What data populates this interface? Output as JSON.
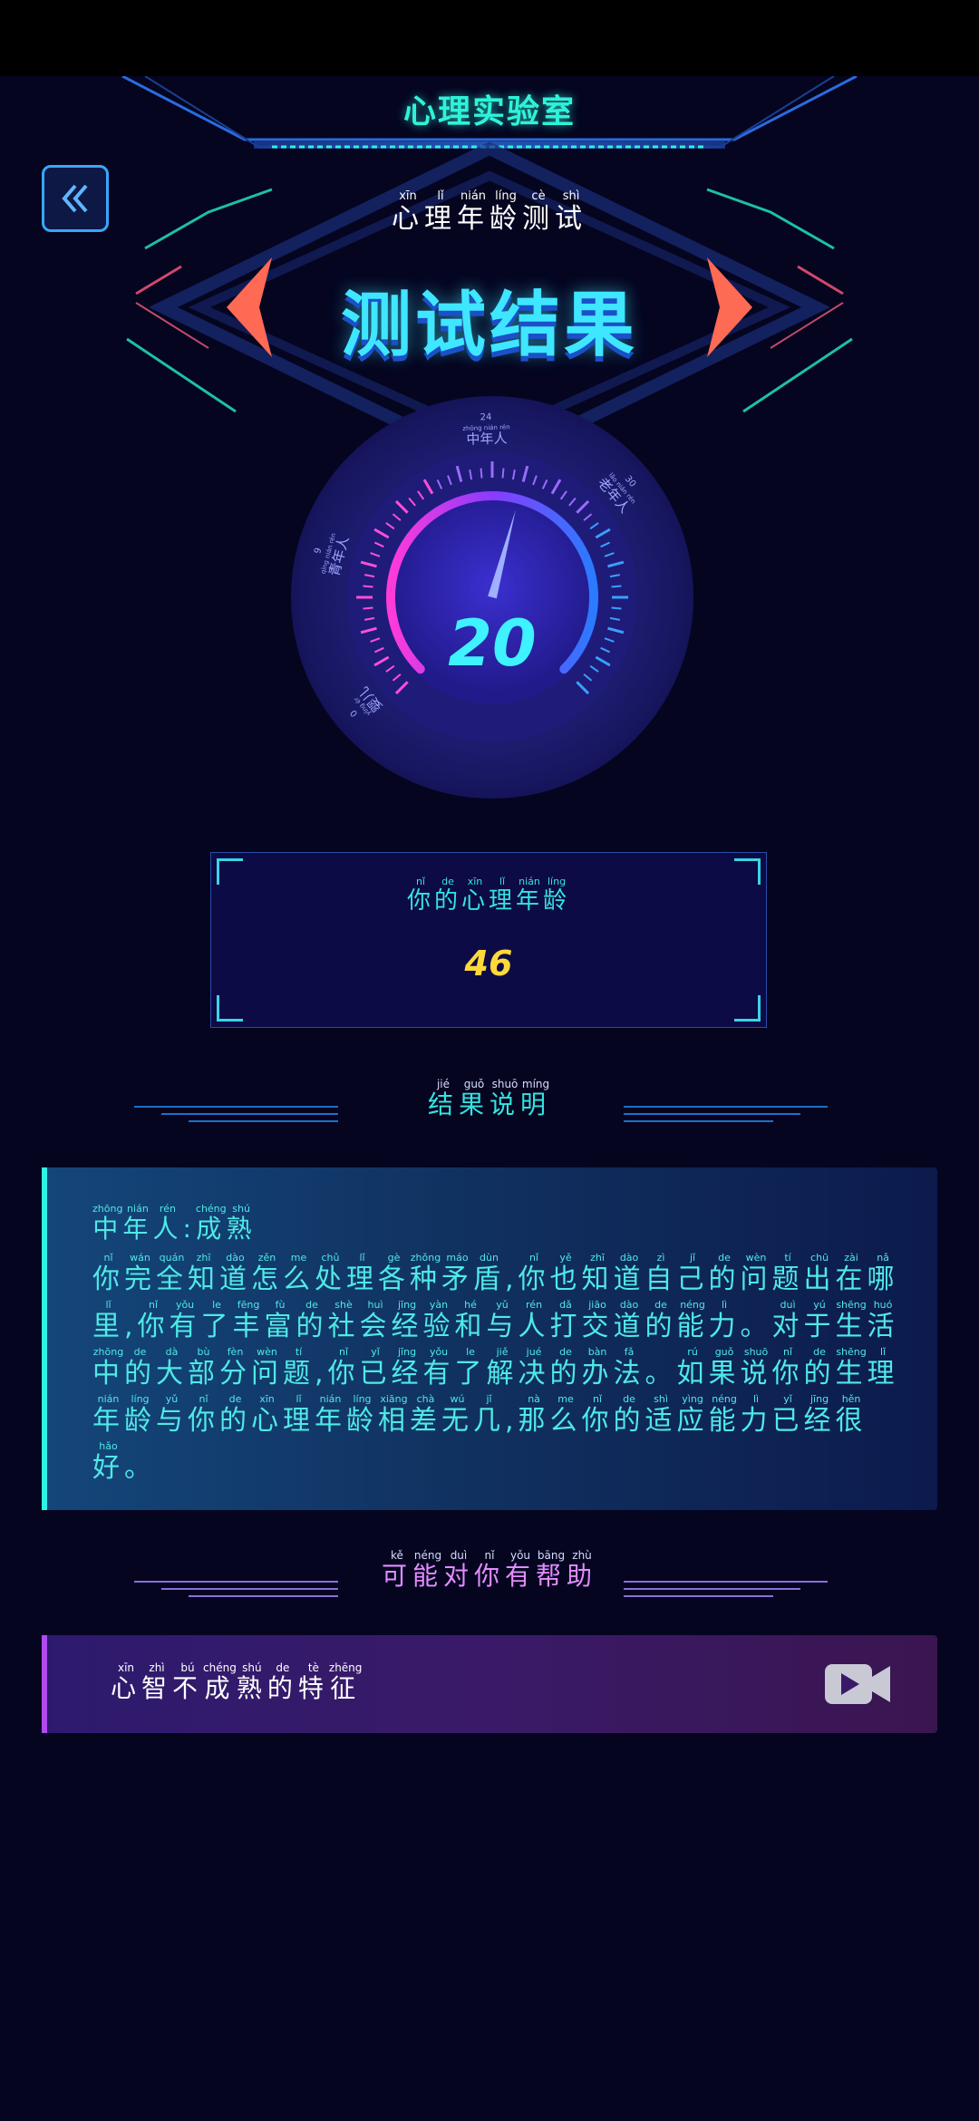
{
  "header": {
    "title": "心理实验室"
  },
  "test_name": {
    "chars": [
      {
        "c": "心",
        "p": "xīn"
      },
      {
        "c": "理",
        "p": "lǐ"
      },
      {
        "c": "年",
        "p": "nián"
      },
      {
        "c": "龄",
        "p": "líng"
      },
      {
        "c": "测",
        "p": "cè"
      },
      {
        "c": "试",
        "p": "shì"
      }
    ]
  },
  "result_title": "测试结果",
  "gauge": {
    "value": 20,
    "min": 0,
    "max": 36,
    "value_label": "20",
    "labels": [
      {
        "num": "0",
        "text": "婴儿",
        "pinyin": "yīng ér"
      },
      {
        "num": "9",
        "text": "青年人",
        "pinyin": "qīng nián rén"
      },
      {
        "num": "24",
        "text": "中年人",
        "pinyin": "zhōng nián rén"
      },
      {
        "num": "30",
        "text": "老年人",
        "pinyin": "lǎo nián rén"
      }
    ]
  },
  "score": {
    "label_chars": [
      {
        "c": "你",
        "p": "nǐ"
      },
      {
        "c": "的",
        "p": "de"
      },
      {
        "c": "心",
        "p": "xīn"
      },
      {
        "c": "理",
        "p": "lǐ"
      },
      {
        "c": "年",
        "p": "nián"
      },
      {
        "c": "龄",
        "p": "líng"
      }
    ],
    "value": "46"
  },
  "explanation_section": {
    "title_chars": [
      {
        "c": "结",
        "p": "jié"
      },
      {
        "c": "果",
        "p": "guǒ"
      },
      {
        "c": "说",
        "p": "shuō"
      },
      {
        "c": "明",
        "p": "míng"
      }
    ],
    "heading_chars": [
      {
        "c": "中",
        "p": "zhōng"
      },
      {
        "c": "年",
        "p": "nián"
      },
      {
        "c": "人",
        "p": "rén"
      },
      {
        "c": ":",
        "p": ""
      },
      {
        "c": "成",
        "p": "chéng"
      },
      {
        "c": "熟",
        "p": "shú"
      }
    ],
    "body_chars": [
      {
        "c": "你",
        "p": "nǐ"
      },
      {
        "c": "完",
        "p": "wán"
      },
      {
        "c": "全",
        "p": "quán"
      },
      {
        "c": "知",
        "p": "zhī"
      },
      {
        "c": "道",
        "p": "dào"
      },
      {
        "c": "怎",
        "p": "zěn"
      },
      {
        "c": "么",
        "p": "me"
      },
      {
        "c": "处",
        "p": "chǔ"
      },
      {
        "c": "理",
        "p": "lǐ"
      },
      {
        "c": "各",
        "p": "gè"
      },
      {
        "c": "种",
        "p": "zhǒng"
      },
      {
        "c": "矛",
        "p": "máo"
      },
      {
        "c": "盾",
        "p": "dùn"
      },
      {
        "c": ",",
        "p": ""
      },
      {
        "c": "你",
        "p": "nǐ"
      },
      {
        "c": "也",
        "p": "yě"
      },
      {
        "c": "知",
        "p": "zhī"
      },
      {
        "c": "道",
        "p": "dào"
      },
      {
        "c": "自",
        "p": "zì"
      },
      {
        "c": "己",
        "p": "jǐ"
      },
      {
        "c": "的",
        "p": "de"
      },
      {
        "c": "问",
        "p": "wèn"
      },
      {
        "c": "题",
        "p": "tí"
      },
      {
        "c": "出",
        "p": "chū"
      },
      {
        "c": "在",
        "p": "zài"
      },
      {
        "c": "哪",
        "p": "nǎ"
      },
      {
        "c": "里",
        "p": "lǐ"
      },
      {
        "c": ",",
        "p": ""
      },
      {
        "c": "你",
        "p": "nǐ"
      },
      {
        "c": "有",
        "p": "yǒu"
      },
      {
        "c": "了",
        "p": "le"
      },
      {
        "c": "丰",
        "p": "fēng"
      },
      {
        "c": "富",
        "p": "fù"
      },
      {
        "c": "的",
        "p": "de"
      },
      {
        "c": "社",
        "p": "shè"
      },
      {
        "c": "会",
        "p": "huì"
      },
      {
        "c": "经",
        "p": "jīng"
      },
      {
        "c": "验",
        "p": "yàn"
      },
      {
        "c": "和",
        "p": "hé"
      },
      {
        "c": "与",
        "p": "yǔ"
      },
      {
        "c": "人",
        "p": "rén"
      },
      {
        "c": "打",
        "p": "dǎ"
      },
      {
        "c": "交",
        "p": "jiāo"
      },
      {
        "c": "道",
        "p": "dào"
      },
      {
        "c": "的",
        "p": "de"
      },
      {
        "c": "能",
        "p": "néng"
      },
      {
        "c": "力",
        "p": "lì"
      },
      {
        "c": "。",
        "p": ""
      },
      {
        "c": "对",
        "p": "duì"
      },
      {
        "c": "于",
        "p": "yú"
      },
      {
        "c": "生",
        "p": "shēng"
      },
      {
        "c": "活",
        "p": "huó"
      },
      {
        "c": "中",
        "p": "zhōng"
      },
      {
        "c": "的",
        "p": "de"
      },
      {
        "c": "大",
        "p": "dà"
      },
      {
        "c": "部",
        "p": "bù"
      },
      {
        "c": "分",
        "p": "fèn"
      },
      {
        "c": "问",
        "p": "wèn"
      },
      {
        "c": "题",
        "p": "tí"
      },
      {
        "c": ",",
        "p": ""
      },
      {
        "c": "你",
        "p": "nǐ"
      },
      {
        "c": "已",
        "p": "yǐ"
      },
      {
        "c": "经",
        "p": "jīng"
      },
      {
        "c": "有",
        "p": "yǒu"
      },
      {
        "c": "了",
        "p": "le"
      },
      {
        "c": "解",
        "p": "jiě"
      },
      {
        "c": "决",
        "p": "jué"
      },
      {
        "c": "的",
        "p": "de"
      },
      {
        "c": "办",
        "p": "bàn"
      },
      {
        "c": "法",
        "p": "fǎ"
      },
      {
        "c": "。",
        "p": ""
      },
      {
        "c": "如",
        "p": "rú"
      },
      {
        "c": "果",
        "p": "guǒ"
      },
      {
        "c": "说",
        "p": "shuō"
      },
      {
        "c": "你",
        "p": "nǐ"
      },
      {
        "c": "的",
        "p": "de"
      },
      {
        "c": "生",
        "p": "shēng"
      },
      {
        "c": "理",
        "p": "lǐ"
      },
      {
        "c": "年",
        "p": "nián"
      },
      {
        "c": "龄",
        "p": "líng"
      },
      {
        "c": "与",
        "p": "yǔ"
      },
      {
        "c": "你",
        "p": "nǐ"
      },
      {
        "c": "的",
        "p": "de"
      },
      {
        "c": "心",
        "p": "xīn"
      },
      {
        "c": "理",
        "p": "lǐ"
      },
      {
        "c": "年",
        "p": "nián"
      },
      {
        "c": "龄",
        "p": "líng"
      },
      {
        "c": "相",
        "p": "xiāng"
      },
      {
        "c": "差",
        "p": "chà"
      },
      {
        "c": "无",
        "p": "wú"
      },
      {
        "c": "几",
        "p": "jǐ"
      },
      {
        "c": ",",
        "p": ""
      },
      {
        "c": "那",
        "p": "nà"
      },
      {
        "c": "么",
        "p": "me"
      },
      {
        "c": "你",
        "p": "nǐ"
      },
      {
        "c": "的",
        "p": "de"
      },
      {
        "c": "适",
        "p": "shì"
      },
      {
        "c": "应",
        "p": "yìng"
      },
      {
        "c": "能",
        "p": "néng"
      },
      {
        "c": "力",
        "p": "lì"
      },
      {
        "c": "已",
        "p": "yǐ"
      },
      {
        "c": "经",
        "p": "jīng"
      },
      {
        "c": "很",
        "p": "hěn"
      },
      {
        "c": "好",
        "p": "hǎo"
      },
      {
        "c": "。",
        "p": ""
      }
    ]
  },
  "help_section": {
    "title_chars": [
      {
        "c": "可",
        "p": "kě"
      },
      {
        "c": "能",
        "p": "néng"
      },
      {
        "c": "对",
        "p": "duì"
      },
      {
        "c": "你",
        "p": "nǐ"
      },
      {
        "c": "有",
        "p": "yǒu"
      },
      {
        "c": "帮",
        "p": "bāng"
      },
      {
        "c": "助",
        "p": "zhù"
      }
    ],
    "item": {
      "chars": [
        {
          "c": "心",
          "p": "xīn"
        },
        {
          "c": "智",
          "p": "zhì"
        },
        {
          "c": "不",
          "p": "bú"
        },
        {
          "c": "成",
          "p": "chéng"
        },
        {
          "c": "熟",
          "p": "shú"
        },
        {
          "c": "的",
          "p": "de"
        },
        {
          "c": "特",
          "p": "tè"
        },
        {
          "c": "征",
          "p": "zhēng"
        }
      ],
      "icon": "video-icon"
    }
  },
  "colors": {
    "accent_cyan": "#2ff2d9",
    "accent_purple": "#b04af0",
    "score_yellow": "#ffd93a",
    "bg": "#050520"
  }
}
